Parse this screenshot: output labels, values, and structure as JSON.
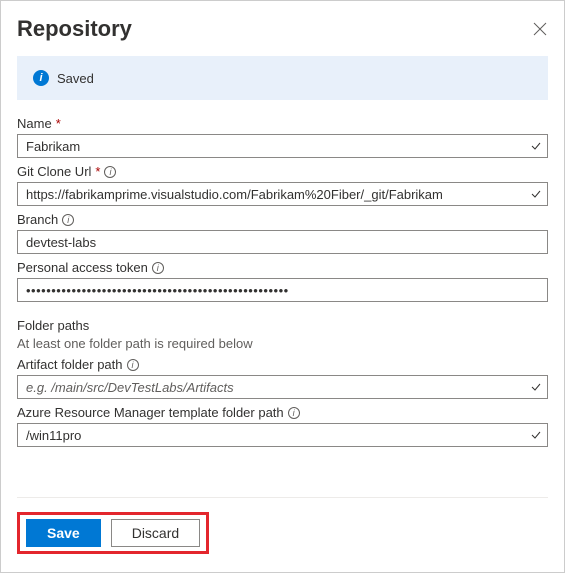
{
  "header": {
    "title": "Repository"
  },
  "status": {
    "text": "Saved"
  },
  "fields": {
    "name": {
      "label": "Name",
      "value": "Fabrikam"
    },
    "gitCloneUrl": {
      "label": "Git Clone Url",
      "value": "https://fabrikamprime.visualstudio.com/Fabrikam%20Fiber/_git/Fabrikam"
    },
    "branch": {
      "label": "Branch",
      "value": "devtest-labs"
    },
    "pat": {
      "label": "Personal access token",
      "value": "••••••••••••••••••••••••••••••••••••••••••••••••••••"
    }
  },
  "folderPaths": {
    "section": "Folder paths",
    "hint": "At least one folder path is required below",
    "artifact": {
      "label": "Artifact folder path",
      "placeholder": "e.g. /main/src/DevTestLabs/Artifacts",
      "value": ""
    },
    "arm": {
      "label": "Azure Resource Manager template folder path",
      "value": "/win11pro"
    }
  },
  "buttons": {
    "save": "Save",
    "discard": "Discard"
  }
}
